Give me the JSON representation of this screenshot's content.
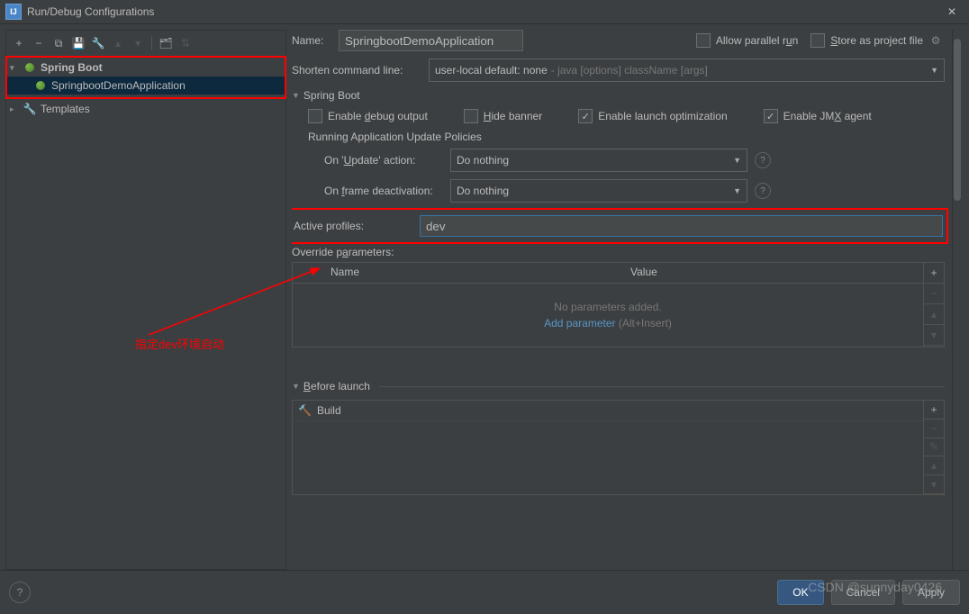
{
  "window": {
    "title": "Run/Debug Configurations"
  },
  "tree": {
    "root": "Spring Boot",
    "leaf": "SpringbootDemoApplication",
    "templates": "Templates"
  },
  "form": {
    "name_label": "Name:",
    "name_value": "SpringbootDemoApplication",
    "allow_parallel": "Allow parallel run",
    "store_project": "Store as project file",
    "shorten_label": "Shorten command line:",
    "shorten_value": "user-local default: none",
    "shorten_hint": "- java [options] className [args]",
    "section_spring": "Spring Boot",
    "enable_debug": "Enable debug output",
    "hide_banner": "Hide banner",
    "enable_launch": "Enable launch optimization",
    "enable_jmx": "Enable JMX agent",
    "update_policies": "Running Application Update Policies",
    "on_update_label": "On 'Update' action:",
    "on_update_value": "Do nothing",
    "on_frame_label": "On frame deactivation:",
    "on_frame_value": "Do nothing",
    "active_profiles_label": "Active profiles:",
    "active_profiles_value": "dev",
    "override_label": "Override parameters:",
    "col_name": "Name",
    "col_value": "Value",
    "no_params": "No parameters added.",
    "add_param": "Add parameter",
    "add_param_kbd": "(Alt+Insert)",
    "before_launch": "Before launch",
    "build": "Build"
  },
  "footer": {
    "ok": "OK",
    "cancel": "Cancel",
    "apply": "Apply"
  },
  "annotation": "指定dev环境启动",
  "watermark": "CSDN @sunnyday0426"
}
